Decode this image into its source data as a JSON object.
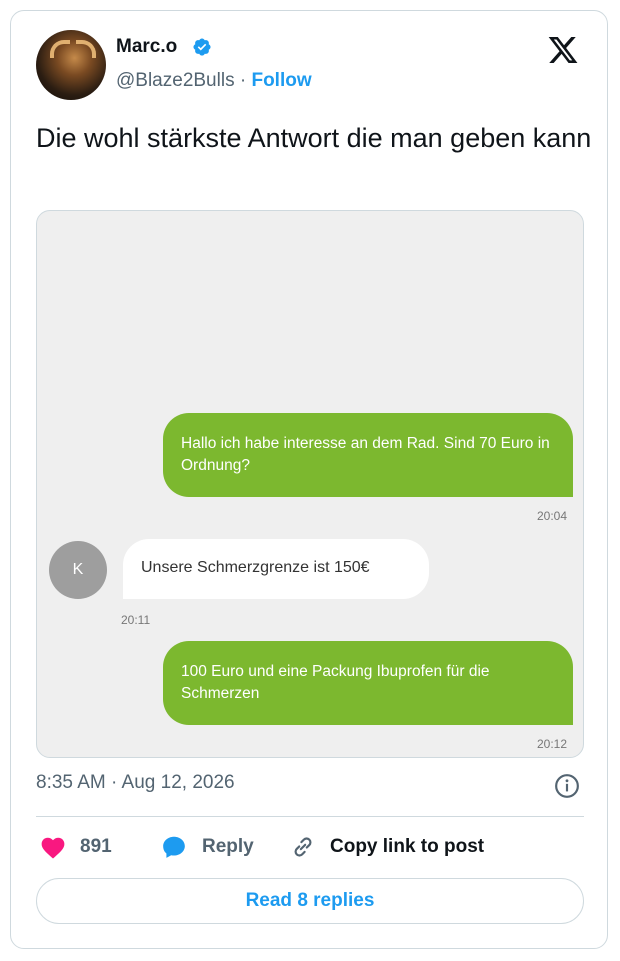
{
  "author": {
    "display_name": "Marc.o",
    "handle": "@Blaze2Bulls",
    "separator": "·",
    "follow_label": "Follow",
    "verified": true
  },
  "tweet": {
    "text": "Die wohl stärkste Antwort die man geben kann"
  },
  "chat": {
    "messages": [
      {
        "direction": "outgoing",
        "text": "Hallo ich habe interesse an dem Rad. Sind 70 Euro in Ordnung?",
        "time": "20:04"
      },
      {
        "direction": "incoming",
        "avatar_letter": "K",
        "text": "Unsere Schmerzgrenze ist 150€",
        "time": "20:11"
      },
      {
        "direction": "outgoing",
        "text": "100 Euro und eine Packung Ibuprofen für die Schmerzen",
        "time": "20:12"
      }
    ]
  },
  "meta": {
    "timestamp": "8:35 AM · Aug 12, 2026"
  },
  "actions": {
    "like_count": "891",
    "reply_label": "Reply",
    "copy_link_label": "Copy link to post"
  },
  "read_replies_label": "Read 8 replies",
  "colors": {
    "accent": "#1d9bf0",
    "like": "#f91880",
    "bubble_green": "#7cb82f"
  },
  "icons": [
    "verified-badge-icon",
    "x-logo-icon",
    "info-icon",
    "heart-icon",
    "reply-bubble-icon",
    "link-icon"
  ]
}
